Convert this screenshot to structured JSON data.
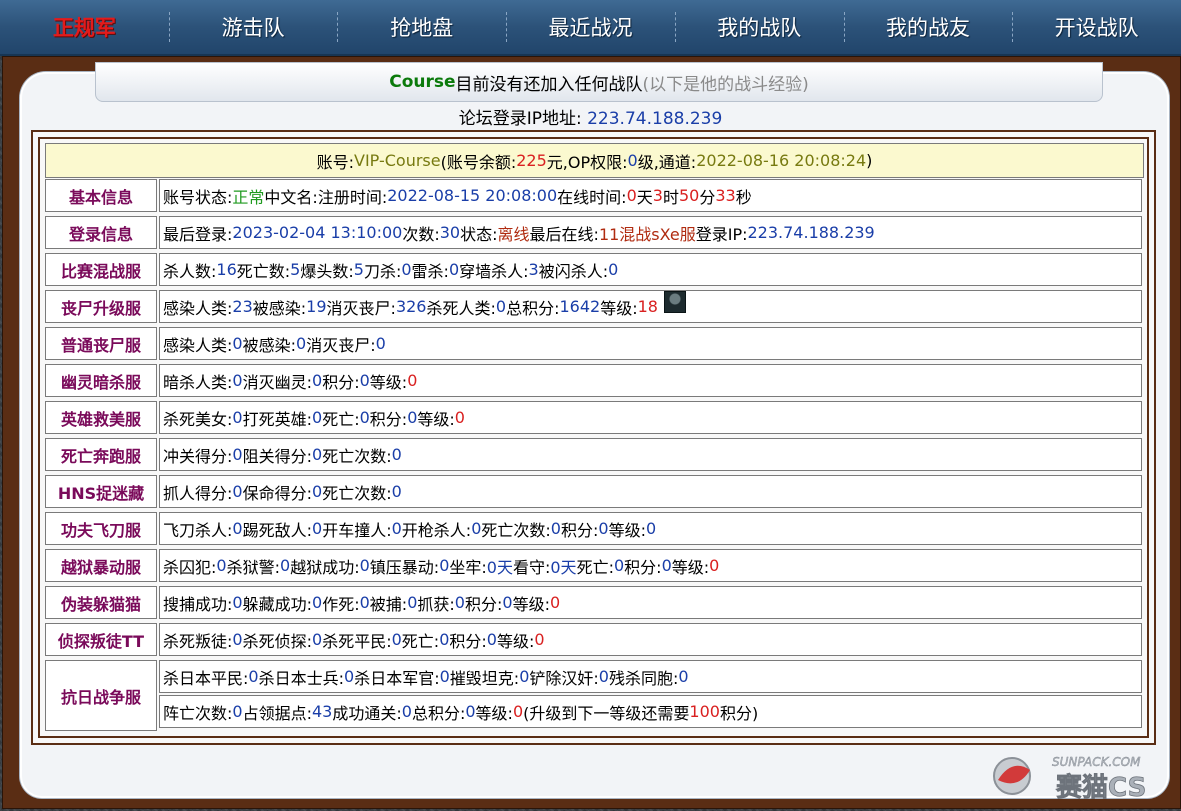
{
  "nav": {
    "items": [
      "正规军",
      "游击队",
      "抢地盘",
      "最近战况",
      "我的战队",
      "我的战友",
      "开设战队"
    ],
    "active_index": 0
  },
  "header": {
    "name": "Course",
    "status": "目前没有还加入任何战队",
    "note": "(以下是他的战斗经验)"
  },
  "ip_line": {
    "label": "论坛登录IP地址:",
    "value": "223.74.188.239"
  },
  "account": {
    "account_label": "账号:",
    "account_value": "VIP-Course",
    "balance_label": "(账号余额:",
    "balance_value": "225",
    "balance_unit": "元,",
    "op_label": "OP权限:",
    "op_value": "0",
    "op_unit": "级,",
    "channel_label": "通道:",
    "channel_value": "2022-08-16 20:08:24",
    "close": ")"
  },
  "rows": [
    {
      "label": "基本信息",
      "fields": [
        {
          "k": "账号状态:",
          "v": "正常",
          "c": "green"
        },
        {
          "k": "中文名:",
          "v": ""
        },
        {
          "k": "注册时间:",
          "v": "2022-08-15 20:08:00",
          "c": "blue"
        },
        {
          "k": "在线时间:",
          "v": "0",
          "c": "red"
        },
        {
          "k": "天",
          "v": "3",
          "c": "red"
        },
        {
          "k": "时",
          "v": "50",
          "c": "red"
        },
        {
          "k": "分",
          "v": "33",
          "c": "red"
        },
        {
          "k": "秒",
          "v": ""
        }
      ]
    },
    {
      "label": "登录信息",
      "fields": [
        {
          "k": "最后登录:",
          "v": "2023-02-04 13:10:00",
          "c": "blue"
        },
        {
          "k": "次数:",
          "v": "30",
          "c": "blue"
        },
        {
          "k": "状态:",
          "v": "离线",
          "c": "dred"
        },
        {
          "k": "最后在线:",
          "v": "11混战sXe服",
          "c": "dred"
        },
        {
          "k": "登录IP:",
          "v": "223.74.188.239",
          "c": "blue"
        }
      ]
    },
    {
      "label": "比赛混战服",
      "fields": [
        {
          "k": "杀人数:",
          "v": "16",
          "c": "blue"
        },
        {
          "k": "死亡数:",
          "v": "5",
          "c": "blue"
        },
        {
          "k": "爆头数:",
          "v": "5",
          "c": "blue"
        },
        {
          "k": "刀杀:",
          "v": "0",
          "c": "blue"
        },
        {
          "k": "雷杀:",
          "v": "0",
          "c": "blue"
        },
        {
          "k": "穿墙杀人:",
          "v": "3",
          "c": "blue"
        },
        {
          "k": "被闪杀人:",
          "v": "0",
          "c": "blue"
        }
      ]
    },
    {
      "label": "丧尸升级服",
      "fields": [
        {
          "k": "感染人类:",
          "v": "23",
          "c": "blue"
        },
        {
          "k": "被感染:",
          "v": "19",
          "c": "blue"
        },
        {
          "k": "消灭丧尸:",
          "v": "326",
          "c": "blue"
        },
        {
          "k": "杀死人类:",
          "v": "0",
          "c": "blue"
        },
        {
          "k": "总积分:",
          "v": "1642",
          "c": "blue"
        },
        {
          "k": "等级:",
          "v": "18",
          "c": "red"
        }
      ],
      "avatar": true
    },
    {
      "label": "普通丧尸服",
      "fields": [
        {
          "k": "感染人类:",
          "v": "0",
          "c": "blue"
        },
        {
          "k": "被感染:",
          "v": "0",
          "c": "blue"
        },
        {
          "k": "消灭丧尸:",
          "v": "0",
          "c": "blue"
        }
      ]
    },
    {
      "label": "幽灵暗杀服",
      "fields": [
        {
          "k": "暗杀人类:",
          "v": "0",
          "c": "blue"
        },
        {
          "k": "消灭幽灵:",
          "v": "0",
          "c": "blue"
        },
        {
          "k": "积分:",
          "v": "0",
          "c": "blue"
        },
        {
          "k": "等级:",
          "v": "0",
          "c": "red"
        }
      ]
    },
    {
      "label": "英雄救美服",
      "fields": [
        {
          "k": "杀死美女:",
          "v": "0",
          "c": "blue"
        },
        {
          "k": "打死英雄:",
          "v": "0",
          "c": "blue"
        },
        {
          "k": "死亡:",
          "v": "0",
          "c": "blue"
        },
        {
          "k": "积分:",
          "v": "0",
          "c": "blue"
        },
        {
          "k": "等级:",
          "v": "0",
          "c": "red"
        }
      ]
    },
    {
      "label": "死亡奔跑服",
      "fields": [
        {
          "k": "冲关得分:",
          "v": "0",
          "c": "blue"
        },
        {
          "k": "阻关得分:",
          "v": "0",
          "c": "blue"
        },
        {
          "k": "死亡次数:",
          "v": "0",
          "c": "blue"
        }
      ]
    },
    {
      "label": "HNS捉迷藏",
      "fields": [
        {
          "k": "抓人得分:",
          "v": "0",
          "c": "blue"
        },
        {
          "k": "保命得分:",
          "v": "0",
          "c": "blue"
        },
        {
          "k": "死亡次数:",
          "v": "0",
          "c": "blue"
        }
      ]
    },
    {
      "label": "功夫飞刀服",
      "fields": [
        {
          "k": "飞刀杀人:",
          "v": "0",
          "c": "blue"
        },
        {
          "k": "踢死敌人:",
          "v": "0",
          "c": "blue"
        },
        {
          "k": "开车撞人:",
          "v": "0",
          "c": "blue"
        },
        {
          "k": "开枪杀人:",
          "v": "0",
          "c": "blue"
        },
        {
          "k": "死亡次数:",
          "v": "0",
          "c": "blue"
        },
        {
          "k": "积分:",
          "v": "0",
          "c": "blue"
        },
        {
          "k": "等级:",
          "v": "0",
          "c": "blue"
        }
      ]
    },
    {
      "label": "越狱暴动服",
      "fields": [
        {
          "k": "杀囚犯:",
          "v": "0",
          "c": "blue"
        },
        {
          "k": "杀狱警:",
          "v": "0",
          "c": "blue"
        },
        {
          "k": "越狱成功:",
          "v": "0",
          "c": "blue"
        },
        {
          "k": "镇压暴动:",
          "v": "0",
          "c": "blue"
        },
        {
          "k": "坐牢:",
          "v": "0天",
          "c": "blue"
        },
        {
          "k": "看守:",
          "v": "0天",
          "c": "blue"
        },
        {
          "k": "死亡:",
          "v": "0",
          "c": "blue"
        },
        {
          "k": "积分:",
          "v": "0",
          "c": "blue"
        },
        {
          "k": "等级:",
          "v": "0",
          "c": "red"
        }
      ]
    },
    {
      "label": "伪装躲猫猫",
      "fields": [
        {
          "k": "搜捕成功:",
          "v": "0",
          "c": "blue"
        },
        {
          "k": "躲藏成功:",
          "v": "0",
          "c": "blue"
        },
        {
          "k": "作死:",
          "v": "0",
          "c": "blue"
        },
        {
          "k": "被捕:",
          "v": "0",
          "c": "blue"
        },
        {
          "k": "抓获:",
          "v": "0",
          "c": "blue"
        },
        {
          "k": "积分:",
          "v": "0",
          "c": "blue"
        },
        {
          "k": "等级:",
          "v": "0",
          "c": "red"
        }
      ]
    },
    {
      "label": "侦探叛徒TT",
      "fields": [
        {
          "k": "杀死叛徒:",
          "v": "0",
          "c": "blue"
        },
        {
          "k": "杀死侦探:",
          "v": "0",
          "c": "blue"
        },
        {
          "k": "杀死平民:",
          "v": "0",
          "c": "blue"
        },
        {
          "k": "死亡:",
          "v": "0",
          "c": "blue"
        },
        {
          "k": "积分:",
          "v": "0",
          "c": "blue"
        },
        {
          "k": "等级:",
          "v": "0",
          "c": "red"
        }
      ]
    }
  ],
  "last_row": {
    "label": "抗日战争服",
    "line1": [
      {
        "k": "杀日本平民:",
        "v": "0",
        "c": "blue"
      },
      {
        "k": "杀日本士兵:",
        "v": "0",
        "c": "blue"
      },
      {
        "k": "杀日本军官:",
        "v": "0",
        "c": "blue"
      },
      {
        "k": "摧毁坦克:",
        "v": "0",
        "c": "blue"
      },
      {
        "k": "铲除汉奸:",
        "v": "0",
        "c": "blue"
      },
      {
        "k": "残杀同胞:",
        "v": "0",
        "c": "blue"
      }
    ],
    "line2": [
      {
        "k": "阵亡次数:",
        "v": "0",
        "c": "blue"
      },
      {
        "k": "占领据点:",
        "v": "43",
        "c": "blue"
      },
      {
        "k": "成功通关:",
        "v": "0",
        "c": "blue"
      },
      {
        "k": "总积分:",
        "v": "0",
        "c": "blue"
      },
      {
        "k": "等级:",
        "v": "0",
        "c": "red"
      }
    ],
    "upgrade_prefix": "(升级到下一等级还需要",
    "upgrade_value": "100",
    "upgrade_suffix": "积分)"
  },
  "watermark": {
    "text": "SUNPACK.COM",
    "brand": "赛猫CS"
  },
  "colors": {
    "blue": "#1a3ea8",
    "green": "#1f9a1f",
    "red": "#d92020",
    "dred": "#b02b10",
    "label": "#7a0a5a"
  }
}
